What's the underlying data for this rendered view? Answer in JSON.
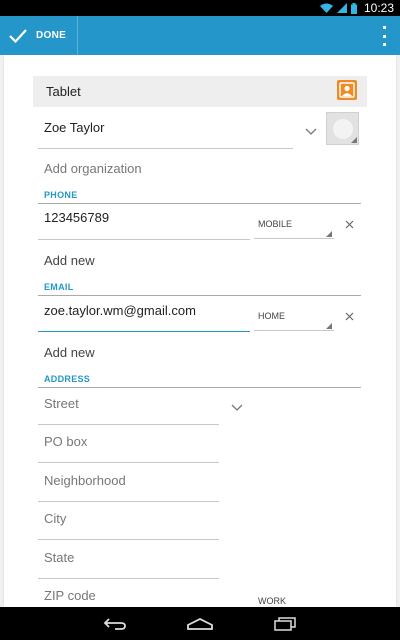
{
  "status_bar": {
    "time": "10:23"
  },
  "action_bar": {
    "done_label": "DONE"
  },
  "account": {
    "label": "Tablet"
  },
  "name": {
    "value": "Zoe Taylor"
  },
  "organization": {
    "placeholder": "Add organization"
  },
  "phone": {
    "header": "PHONE",
    "value": "123456789",
    "type": "MOBILE",
    "add_label": "Add new"
  },
  "email": {
    "header": "EMAIL",
    "value": "zoe.taylor.wm@gmail.com",
    "type": "HOME",
    "add_label": "Add new"
  },
  "address": {
    "header": "ADDRESS",
    "street": "Street",
    "po_box": "PO box",
    "neighborhood": "Neighborhood",
    "city": "City",
    "state": "State",
    "zip": "ZIP code",
    "type": "WORK"
  },
  "colors": {
    "accent": "#2596c9",
    "account_icon": "#f08a24"
  },
  "icons": {
    "status": [
      "wifi-icon",
      "signal-icon",
      "battery-icon"
    ],
    "nav": [
      "back-icon",
      "home-icon",
      "recents-icon"
    ]
  }
}
